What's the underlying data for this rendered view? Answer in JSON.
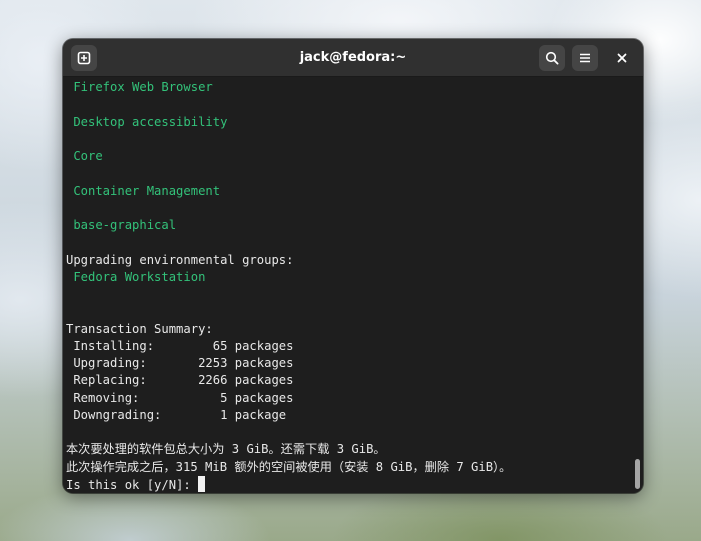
{
  "window": {
    "title": "jack@fedora:~"
  },
  "icons": {
    "new_tab": "new-tab-icon",
    "search": "search-icon",
    "menu": "hamburger-menu-icon",
    "close": "close-icon"
  },
  "colors": {
    "terminal_bg": "#1e1e1e",
    "headerbar_bg": "#303030",
    "group_text": "#33c27a",
    "normal_text": "#e8e8e8"
  },
  "terminal": {
    "lines": [
      {
        "text": " Firefox Web Browser",
        "style": "green"
      },
      {
        "text": "",
        "style": "white"
      },
      {
        "text": " Desktop accessibility",
        "style": "green"
      },
      {
        "text": "",
        "style": "white"
      },
      {
        "text": " Core",
        "style": "green"
      },
      {
        "text": "",
        "style": "white"
      },
      {
        "text": " Container Management",
        "style": "green"
      },
      {
        "text": "",
        "style": "white"
      },
      {
        "text": " base-graphical",
        "style": "green"
      },
      {
        "text": "",
        "style": "white"
      },
      {
        "text": "Upgrading environmental groups:",
        "style": "white"
      },
      {
        "text": " Fedora Workstation",
        "style": "green"
      },
      {
        "text": "",
        "style": "white"
      },
      {
        "text": "",
        "style": "white"
      },
      {
        "text": "Transaction Summary:",
        "style": "white"
      },
      {
        "text": " Installing:        65 packages",
        "style": "white"
      },
      {
        "text": " Upgrading:       2253 packages",
        "style": "white"
      },
      {
        "text": " Replacing:       2266 packages",
        "style": "white"
      },
      {
        "text": " Removing:           5 packages",
        "style": "white"
      },
      {
        "text": " Downgrading:        1 package",
        "style": "white"
      },
      {
        "text": "",
        "style": "white"
      },
      {
        "text": "本次要处理的软件包总大小为 3 GiB。还需下载 3 GiB。",
        "style": "white"
      },
      {
        "text": "此次操作完成之后，315 MiB 额外的空间被使用（安装 8 GiB，删除 7 GiB）。",
        "style": "white"
      }
    ],
    "prompt": "Is this ok [y/N]: "
  }
}
